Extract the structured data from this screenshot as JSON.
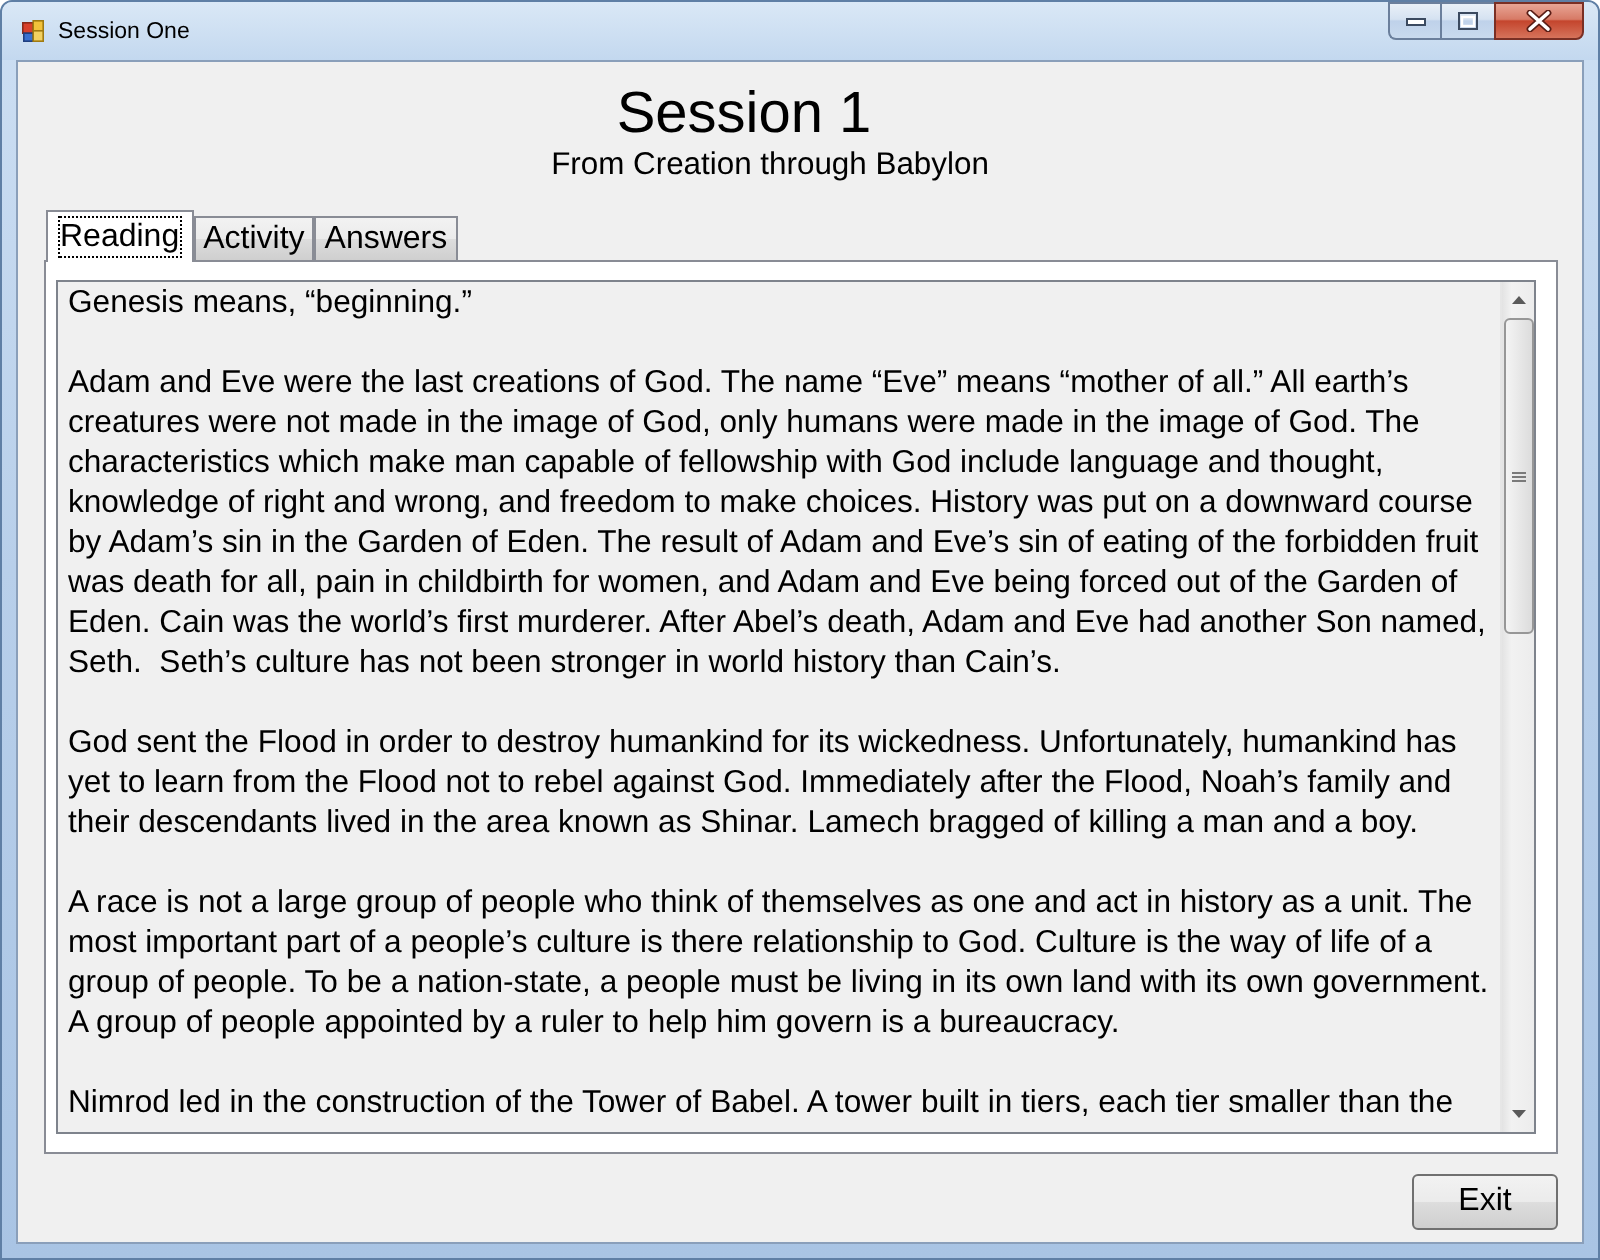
{
  "window": {
    "title": "Session One"
  },
  "header": {
    "title": "Session 1",
    "subtitle": "From Creation through Babylon"
  },
  "tabs": [
    {
      "label": "Reading",
      "selected": true
    },
    {
      "label": "Activity",
      "selected": false
    },
    {
      "label": "Answers",
      "selected": false
    }
  ],
  "reading": {
    "paragraphs": [
      "Genesis means, “beginning.”",
      "Adam and Eve were the last creations of God. The name “Eve” means “mother of all.” All earth’s creatures were not made in the image of God, only humans were made in the image of God. The characteristics which make man capable of fellowship with God include language and thought, knowledge of right and wrong, and freedom to make choices. History was put on a downward course by Adam’s sin in the Garden of Eden. The result of Adam and Eve’s sin of eating of the forbidden fruit was death for all, pain in childbirth for women, and Adam and Eve being forced out of the Garden of Eden. Cain was the world’s first murderer. After Abel’s death, Adam and Eve had another Son named, Seth.  Seth’s culture has not been stronger in world history than Cain’s.",
      "God sent the Flood in order to destroy humankind for its wickedness. Unfortunately, humankind has yet to learn from the Flood not to rebel against God. Immediately after the Flood, Noah’s family and their descendants lived in the area known as Shinar. Lamech bragged of killing a man and a boy.",
      "A race is not a large group of people who think of themselves as one and act in history as a unit. The most important part of a people’s culture is there relationship to God. Culture is the way of life of a group of people. To be a nation-state, a people must be living in its own land with its own government. A group of people appointed by a ruler to help him govern is a bureaucracy.",
      "Nimrod led in the construction of the Tower of Babel. A tower built in tiers, each tier smaller than the"
    ]
  },
  "buttons": [
    {
      "label": "Exit"
    }
  ]
}
